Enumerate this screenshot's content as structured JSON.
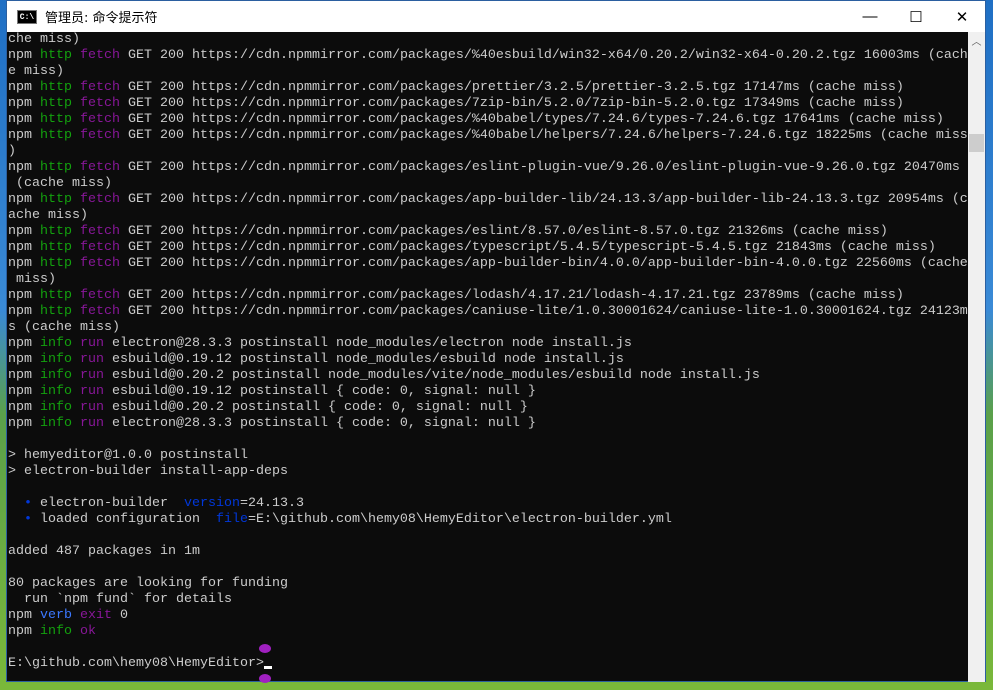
{
  "window": {
    "title": "管理员: 命令提示符",
    "icon": "cmd-icon",
    "minimize": "—",
    "maximize": "☐",
    "close": "✕"
  },
  "colors": {
    "w": "#cccccc",
    "g": "#13a10e",
    "m": "#881798",
    "b": "#3b78ff",
    "d": "#0037da"
  },
  "lines": [
    [
      [
        "che miss)",
        "w"
      ]
    ],
    [
      [
        "npm ",
        "w"
      ],
      [
        "http ",
        "g"
      ],
      [
        "fetch ",
        "m"
      ],
      [
        "GET 200 https://cdn.npmmirror.com/packages/%40esbuild/win32-x64/0.20.2/win32-x64-0.20.2.tgz 16003ms (cach",
        "w"
      ]
    ],
    [
      [
        "e miss)",
        "w"
      ]
    ],
    [
      [
        "npm ",
        "w"
      ],
      [
        "http ",
        "g"
      ],
      [
        "fetch ",
        "m"
      ],
      [
        "GET 200 https://cdn.npmmirror.com/packages/prettier/3.2.5/prettier-3.2.5.tgz 17147ms (cache miss)",
        "w"
      ]
    ],
    [
      [
        "npm ",
        "w"
      ],
      [
        "http ",
        "g"
      ],
      [
        "fetch ",
        "m"
      ],
      [
        "GET 200 https://cdn.npmmirror.com/packages/7zip-bin/5.2.0/7zip-bin-5.2.0.tgz 17349ms (cache miss)",
        "w"
      ]
    ],
    [
      [
        "npm ",
        "w"
      ],
      [
        "http ",
        "g"
      ],
      [
        "fetch ",
        "m"
      ],
      [
        "GET 200 https://cdn.npmmirror.com/packages/%40babel/types/7.24.6/types-7.24.6.tgz 17641ms (cache miss)",
        "w"
      ]
    ],
    [
      [
        "npm ",
        "w"
      ],
      [
        "http ",
        "g"
      ],
      [
        "fetch ",
        "m"
      ],
      [
        "GET 200 https://cdn.npmmirror.com/packages/%40babel/helpers/7.24.6/helpers-7.24.6.tgz 18225ms (cache miss",
        "w"
      ]
    ],
    [
      [
        ")",
        "w"
      ]
    ],
    [
      [
        "npm ",
        "w"
      ],
      [
        "http ",
        "g"
      ],
      [
        "fetch ",
        "m"
      ],
      [
        "GET 200 https://cdn.npmmirror.com/packages/eslint-plugin-vue/9.26.0/eslint-plugin-vue-9.26.0.tgz 20470ms",
        "w"
      ]
    ],
    [
      [
        " (cache miss)",
        "w"
      ]
    ],
    [
      [
        "npm ",
        "w"
      ],
      [
        "http ",
        "g"
      ],
      [
        "fetch ",
        "m"
      ],
      [
        "GET 200 https://cdn.npmmirror.com/packages/app-builder-lib/24.13.3/app-builder-lib-24.13.3.tgz 20954ms (c",
        "w"
      ]
    ],
    [
      [
        "ache miss)",
        "w"
      ]
    ],
    [
      [
        "npm ",
        "w"
      ],
      [
        "http ",
        "g"
      ],
      [
        "fetch ",
        "m"
      ],
      [
        "GET 200 https://cdn.npmmirror.com/packages/eslint/8.57.0/eslint-8.57.0.tgz 21326ms (cache miss)",
        "w"
      ]
    ],
    [
      [
        "npm ",
        "w"
      ],
      [
        "http ",
        "g"
      ],
      [
        "fetch ",
        "m"
      ],
      [
        "GET 200 https://cdn.npmmirror.com/packages/typescript/5.4.5/typescript-5.4.5.tgz 21843ms (cache miss)",
        "w"
      ]
    ],
    [
      [
        "npm ",
        "w"
      ],
      [
        "http ",
        "g"
      ],
      [
        "fetch ",
        "m"
      ],
      [
        "GET 200 https://cdn.npmmirror.com/packages/app-builder-bin/4.0.0/app-builder-bin-4.0.0.tgz 22560ms (cache",
        "w"
      ]
    ],
    [
      [
        " miss)",
        "w"
      ]
    ],
    [
      [
        "npm ",
        "w"
      ],
      [
        "http ",
        "g"
      ],
      [
        "fetch ",
        "m"
      ],
      [
        "GET 200 https://cdn.npmmirror.com/packages/lodash/4.17.21/lodash-4.17.21.tgz 23789ms (cache miss)",
        "w"
      ]
    ],
    [
      [
        "npm ",
        "w"
      ],
      [
        "http ",
        "g"
      ],
      [
        "fetch ",
        "m"
      ],
      [
        "GET 200 https://cdn.npmmirror.com/packages/caniuse-lite/1.0.30001624/caniuse-lite-1.0.30001624.tgz 24123m",
        "w"
      ]
    ],
    [
      [
        "s (cache miss)",
        "w"
      ]
    ],
    [
      [
        "npm ",
        "w"
      ],
      [
        "info ",
        "g"
      ],
      [
        "run ",
        "m"
      ],
      [
        "electron@28.3.3 postinstall node_modules/electron node install.js",
        "w"
      ]
    ],
    [
      [
        "npm ",
        "w"
      ],
      [
        "info ",
        "g"
      ],
      [
        "run ",
        "m"
      ],
      [
        "esbuild@0.19.12 postinstall node_modules/esbuild node install.js",
        "w"
      ]
    ],
    [
      [
        "npm ",
        "w"
      ],
      [
        "info ",
        "g"
      ],
      [
        "run ",
        "m"
      ],
      [
        "esbuild@0.20.2 postinstall node_modules/vite/node_modules/esbuild node install.js",
        "w"
      ]
    ],
    [
      [
        "npm ",
        "w"
      ],
      [
        "info ",
        "g"
      ],
      [
        "run ",
        "m"
      ],
      [
        "esbuild@0.19.12 postinstall { code: 0, signal: null }",
        "w"
      ]
    ],
    [
      [
        "npm ",
        "w"
      ],
      [
        "info ",
        "g"
      ],
      [
        "run ",
        "m"
      ],
      [
        "esbuild@0.20.2 postinstall { code: 0, signal: null }",
        "w"
      ]
    ],
    [
      [
        "npm ",
        "w"
      ],
      [
        "info ",
        "g"
      ],
      [
        "run ",
        "m"
      ],
      [
        "electron@28.3.3 postinstall { code: 0, signal: null }",
        "w"
      ]
    ],
    [],
    [
      [
        "> hemyeditor@1.0.0 postinstall",
        "w"
      ]
    ],
    [
      [
        "> electron-builder install-app-deps",
        "w"
      ]
    ],
    [],
    [
      [
        "  ",
        "w"
      ],
      [
        "•",
        "d"
      ],
      [
        " electron-builder  ",
        "w"
      ],
      [
        "version",
        "d"
      ],
      [
        "=24.13.3",
        "w"
      ]
    ],
    [
      [
        "  ",
        "w"
      ],
      [
        "•",
        "d"
      ],
      [
        " loaded configuration  ",
        "w"
      ],
      [
        "file",
        "d"
      ],
      [
        "=E:\\github.com\\hemy08\\HemyEditor\\electron-builder.yml",
        "w"
      ]
    ],
    [],
    [
      [
        "added 487 packages in 1m",
        "w"
      ]
    ],
    [],
    [
      [
        "80 packages are looking for funding",
        "w"
      ]
    ],
    [
      [
        "  run `npm fund` for details",
        "w"
      ]
    ],
    [
      [
        "npm ",
        "w"
      ],
      [
        "verb ",
        "b"
      ],
      [
        "exit ",
        "m"
      ],
      [
        "0",
        "w"
      ]
    ],
    [
      [
        "npm ",
        "w"
      ],
      [
        "info ",
        "g"
      ],
      [
        "ok",
        "m"
      ]
    ],
    [],
    [
      [
        "E:\\github.com\\hemy08\\HemyEditor>",
        "w"
      ]
    ]
  ]
}
